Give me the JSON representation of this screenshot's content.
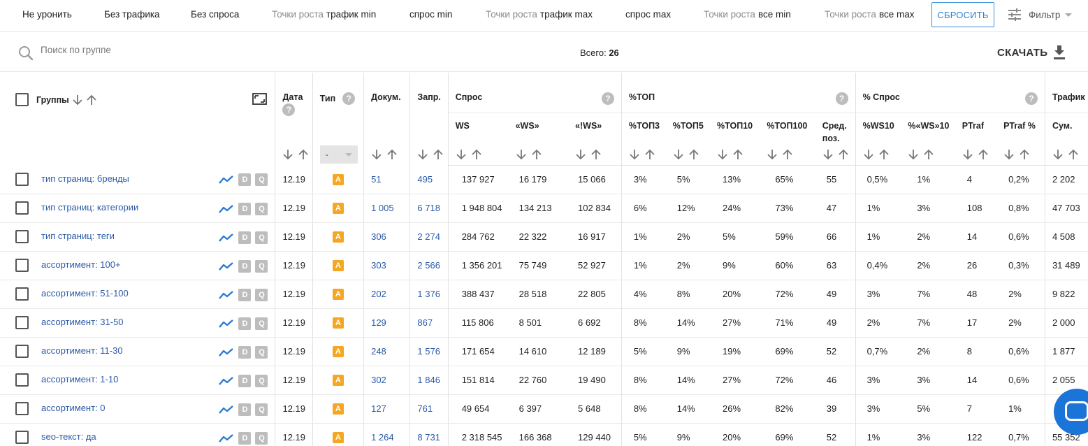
{
  "filters": [
    {
      "prefix": "",
      "label": "Не уронить"
    },
    {
      "prefix": "",
      "label": "Без трафика"
    },
    {
      "prefix": "",
      "label": "Без спроса"
    },
    {
      "prefix": "Точки роста",
      "label": "трафик min"
    },
    {
      "prefix": "",
      "label": "спрос min"
    },
    {
      "prefix": "Точки роста",
      "label": "трафик max"
    },
    {
      "prefix": "",
      "label": "спрос max"
    },
    {
      "prefix": "Точки роста",
      "label": "все min"
    },
    {
      "prefix": "Точки роста",
      "label": "все max"
    }
  ],
  "reset_label": "СБРОСИТЬ",
  "filter_label": "Фильтр",
  "search": {
    "placeholder": "Поиск по группе",
    "value": ""
  },
  "total": {
    "label": "Всего:",
    "value": "26"
  },
  "download_label": "СКАЧАТЬ",
  "headers": {
    "groups": "Группы",
    "date": "Дата",
    "type": "Тип",
    "type_filter": "-",
    "docs": "Докум.",
    "queries": "Запр.",
    "demand": "Спрос",
    "ws": "WS",
    "qws": "«WS»",
    "eqws": "«!WS»",
    "top": "%ТОП",
    "top3": "%ТОП3",
    "top5": "%ТОП5",
    "top10": "%ТОП10",
    "top100": "%ТОП100",
    "avgpos": "Сред. поз.",
    "demand_pct": "% Спрос",
    "ws10": "%WS10",
    "qws10": "%«WS»10",
    "ptraf": "PTraf",
    "ptraf_pct": "PTraf %",
    "traffic": "Трафик",
    "sum": "Сум."
  },
  "rows": [
    {
      "name": "тип страниц: бренды",
      "date": "12.19",
      "type": "A",
      "docs": "51",
      "queries": "495",
      "ws": "137 927",
      "qws": "16 179",
      "eqws": "15 066",
      "top3": "3%",
      "top5": "5%",
      "top10": "13%",
      "top100": "65%",
      "avgpos": "55",
      "ws10": "0,5%",
      "qws10": "1%",
      "ptraf": "4",
      "ptraf_pct": "0,2%",
      "sum": "2 202"
    },
    {
      "name": "тип страниц: категории",
      "date": "12.19",
      "type": "A",
      "docs": "1 005",
      "queries": "6 718",
      "ws": "1 948 804",
      "qws": "134 213",
      "eqws": "102 834",
      "top3": "6%",
      "top5": "12%",
      "top10": "24%",
      "top100": "73%",
      "avgpos": "47",
      "ws10": "1%",
      "qws10": "3%",
      "ptraf": "108",
      "ptraf_pct": "0,8%",
      "sum": "47 703"
    },
    {
      "name": "тип страниц: теги",
      "date": "12.19",
      "type": "A",
      "docs": "306",
      "queries": "2 274",
      "ws": "284 762",
      "qws": "22 322",
      "eqws": "16 917",
      "top3": "1%",
      "top5": "2%",
      "top10": "5%",
      "top100": "59%",
      "avgpos": "66",
      "ws10": "1%",
      "qws10": "2%",
      "ptraf": "14",
      "ptraf_pct": "0,6%",
      "sum": "4 508"
    },
    {
      "name": "ассортимент: 100+",
      "date": "12.19",
      "type": "A",
      "docs": "303",
      "queries": "2 566",
      "ws": "1 356 201",
      "qws": "75 749",
      "eqws": "52 927",
      "top3": "1%",
      "top5": "2%",
      "top10": "9%",
      "top100": "60%",
      "avgpos": "63",
      "ws10": "0,4%",
      "qws10": "2%",
      "ptraf": "26",
      "ptraf_pct": "0,3%",
      "sum": "31 489"
    },
    {
      "name": "ассортимент: 51-100",
      "date": "12.19",
      "type": "A",
      "docs": "202",
      "queries": "1 376",
      "ws": "388 437",
      "qws": "28 518",
      "eqws": "22 805",
      "top3": "4%",
      "top5": "8%",
      "top10": "20%",
      "top100": "72%",
      "avgpos": "49",
      "ws10": "3%",
      "qws10": "7%",
      "ptraf": "48",
      "ptraf_pct": "2%",
      "sum": "9 822"
    },
    {
      "name": "ассортимент: 31-50",
      "date": "12.19",
      "type": "A",
      "docs": "129",
      "queries": "867",
      "ws": "115 806",
      "qws": "8 501",
      "eqws": "6 692",
      "top3": "8%",
      "top5": "14%",
      "top10": "27%",
      "top100": "71%",
      "avgpos": "49",
      "ws10": "2%",
      "qws10": "7%",
      "ptraf": "17",
      "ptraf_pct": "2%",
      "sum": "2 000"
    },
    {
      "name": "ассортимент: 11-30",
      "date": "12.19",
      "type": "A",
      "docs": "248",
      "queries": "1 576",
      "ws": "171 654",
      "qws": "14 610",
      "eqws": "12 189",
      "top3": "5%",
      "top5": "9%",
      "top10": "19%",
      "top100": "69%",
      "avgpos": "52",
      "ws10": "0,7%",
      "qws10": "2%",
      "ptraf": "8",
      "ptraf_pct": "0,6%",
      "sum": "1 877"
    },
    {
      "name": "ассортимент: 1-10",
      "date": "12.19",
      "type": "A",
      "docs": "302",
      "queries": "1 846",
      "ws": "151 814",
      "qws": "22 760",
      "eqws": "19 490",
      "top3": "8%",
      "top5": "14%",
      "top10": "27%",
      "top100": "72%",
      "avgpos": "46",
      "ws10": "3%",
      "qws10": "3%",
      "ptraf": "14",
      "ptraf_pct": "0,6%",
      "sum": "2 055"
    },
    {
      "name": "ассортимент: 0",
      "date": "12.19",
      "type": "A",
      "docs": "127",
      "queries": "761",
      "ws": "49 654",
      "qws": "6 397",
      "eqws": "5 648",
      "top3": "8%",
      "top5": "14%",
      "top10": "26%",
      "top100": "82%",
      "avgpos": "39",
      "ws10": "3%",
      "qws10": "5%",
      "ptraf": "7",
      "ptraf_pct": "1%",
      "sum": ""
    },
    {
      "name": "seo-текст: да",
      "date": "12.19",
      "type": "A",
      "docs": "1 264",
      "queries": "8 731",
      "ws": "2 318 545",
      "qws": "166 368",
      "eqws": "129 440",
      "top3": "5%",
      "top5": "9%",
      "top10": "20%",
      "top100": "69%",
      "avgpos": "52",
      "ws10": "1%",
      "qws10": "3%",
      "ptraf": "122",
      "ptraf_pct": "0,7%",
      "sum": "55 352"
    }
  ],
  "row_buttons": {
    "d": "D",
    "q": "Q"
  },
  "colors": {
    "link": "#2b5aa8",
    "badge": "#f5a623",
    "accent": "#1b74d8"
  }
}
